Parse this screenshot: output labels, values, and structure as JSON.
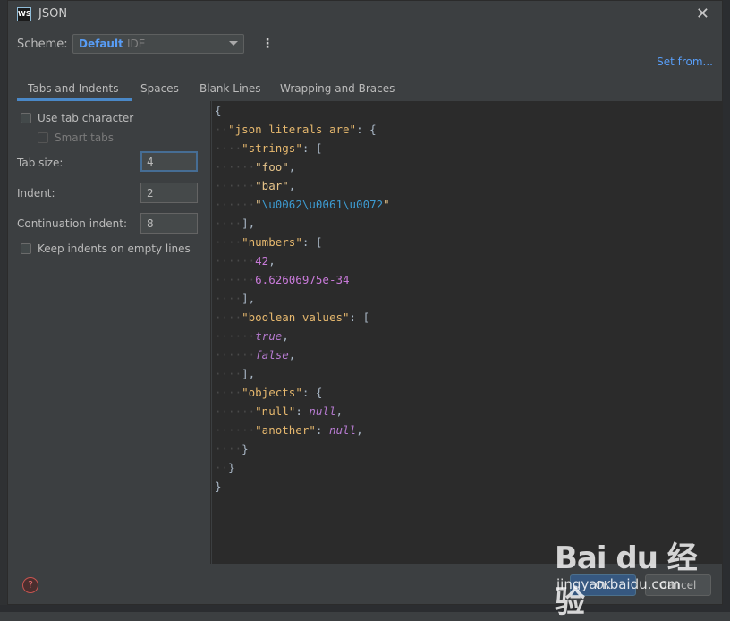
{
  "window": {
    "title": "JSON",
    "app_icon_text": "WS",
    "close_label": "✕"
  },
  "scheme": {
    "label": "Scheme:",
    "name": "Default",
    "sub": "IDE",
    "menu_glyph": "⋮",
    "set_from": "Set from..."
  },
  "tabs": [
    {
      "label": "Tabs and Indents",
      "active": true
    },
    {
      "label": "Spaces"
    },
    {
      "label": "Blank Lines"
    },
    {
      "label": "Wrapping and Braces"
    }
  ],
  "options": {
    "use_tab_character": {
      "label": "Use tab character",
      "checked": false
    },
    "smart_tabs": {
      "label": "Smart tabs",
      "checked": false,
      "disabled": true
    },
    "tab_size": {
      "label": "Tab size:",
      "value": "4"
    },
    "indent": {
      "label": "Indent:",
      "value": "2"
    },
    "continuation_indent": {
      "label": "Continuation indent:",
      "value": "8"
    },
    "keep_indents": {
      "label": "Keep indents on empty lines",
      "checked": false
    }
  },
  "buttons": {
    "help": "?",
    "ok": "OK",
    "cancel": "Cancel"
  },
  "watermark": {
    "main": "Bai du 经验",
    "sub": "jingyan.baidu.com"
  },
  "colors": {
    "accent": "#589df6",
    "tab_underline": "#4a88c7",
    "editor_bg": "#2b2b2b",
    "key": "#e6b86e",
    "number": "#c87ad9",
    "escape": "#3d9bd1"
  }
}
